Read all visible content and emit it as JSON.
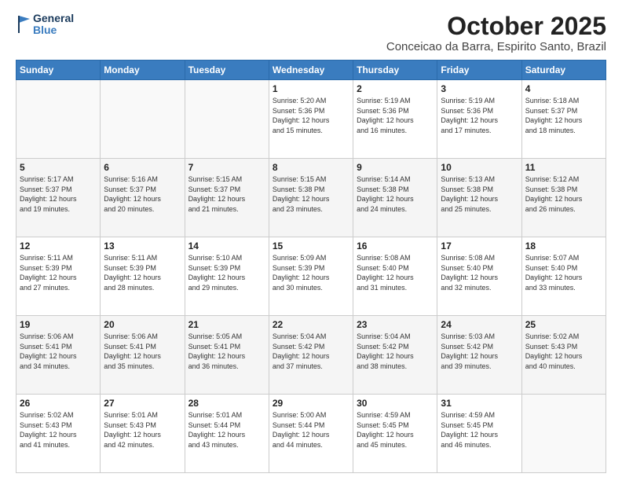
{
  "header": {
    "logo_line1": "General",
    "logo_line2": "Blue",
    "month_title": "October 2025",
    "location": "Conceicao da Barra, Espirito Santo, Brazil"
  },
  "days_of_week": [
    "Sunday",
    "Monday",
    "Tuesday",
    "Wednesday",
    "Thursday",
    "Friday",
    "Saturday"
  ],
  "weeks": [
    [
      {
        "day": "",
        "info": ""
      },
      {
        "day": "",
        "info": ""
      },
      {
        "day": "",
        "info": ""
      },
      {
        "day": "1",
        "info": "Sunrise: 5:20 AM\nSunset: 5:36 PM\nDaylight: 12 hours\nand 15 minutes."
      },
      {
        "day": "2",
        "info": "Sunrise: 5:19 AM\nSunset: 5:36 PM\nDaylight: 12 hours\nand 16 minutes."
      },
      {
        "day": "3",
        "info": "Sunrise: 5:19 AM\nSunset: 5:36 PM\nDaylight: 12 hours\nand 17 minutes."
      },
      {
        "day": "4",
        "info": "Sunrise: 5:18 AM\nSunset: 5:37 PM\nDaylight: 12 hours\nand 18 minutes."
      }
    ],
    [
      {
        "day": "5",
        "info": "Sunrise: 5:17 AM\nSunset: 5:37 PM\nDaylight: 12 hours\nand 19 minutes."
      },
      {
        "day": "6",
        "info": "Sunrise: 5:16 AM\nSunset: 5:37 PM\nDaylight: 12 hours\nand 20 minutes."
      },
      {
        "day": "7",
        "info": "Sunrise: 5:15 AM\nSunset: 5:37 PM\nDaylight: 12 hours\nand 21 minutes."
      },
      {
        "day": "8",
        "info": "Sunrise: 5:15 AM\nSunset: 5:38 PM\nDaylight: 12 hours\nand 23 minutes."
      },
      {
        "day": "9",
        "info": "Sunrise: 5:14 AM\nSunset: 5:38 PM\nDaylight: 12 hours\nand 24 minutes."
      },
      {
        "day": "10",
        "info": "Sunrise: 5:13 AM\nSunset: 5:38 PM\nDaylight: 12 hours\nand 25 minutes."
      },
      {
        "day": "11",
        "info": "Sunrise: 5:12 AM\nSunset: 5:38 PM\nDaylight: 12 hours\nand 26 minutes."
      }
    ],
    [
      {
        "day": "12",
        "info": "Sunrise: 5:11 AM\nSunset: 5:39 PM\nDaylight: 12 hours\nand 27 minutes."
      },
      {
        "day": "13",
        "info": "Sunrise: 5:11 AM\nSunset: 5:39 PM\nDaylight: 12 hours\nand 28 minutes."
      },
      {
        "day": "14",
        "info": "Sunrise: 5:10 AM\nSunset: 5:39 PM\nDaylight: 12 hours\nand 29 minutes."
      },
      {
        "day": "15",
        "info": "Sunrise: 5:09 AM\nSunset: 5:39 PM\nDaylight: 12 hours\nand 30 minutes."
      },
      {
        "day": "16",
        "info": "Sunrise: 5:08 AM\nSunset: 5:40 PM\nDaylight: 12 hours\nand 31 minutes."
      },
      {
        "day": "17",
        "info": "Sunrise: 5:08 AM\nSunset: 5:40 PM\nDaylight: 12 hours\nand 32 minutes."
      },
      {
        "day": "18",
        "info": "Sunrise: 5:07 AM\nSunset: 5:40 PM\nDaylight: 12 hours\nand 33 minutes."
      }
    ],
    [
      {
        "day": "19",
        "info": "Sunrise: 5:06 AM\nSunset: 5:41 PM\nDaylight: 12 hours\nand 34 minutes."
      },
      {
        "day": "20",
        "info": "Sunrise: 5:06 AM\nSunset: 5:41 PM\nDaylight: 12 hours\nand 35 minutes."
      },
      {
        "day": "21",
        "info": "Sunrise: 5:05 AM\nSunset: 5:41 PM\nDaylight: 12 hours\nand 36 minutes."
      },
      {
        "day": "22",
        "info": "Sunrise: 5:04 AM\nSunset: 5:42 PM\nDaylight: 12 hours\nand 37 minutes."
      },
      {
        "day": "23",
        "info": "Sunrise: 5:04 AM\nSunset: 5:42 PM\nDaylight: 12 hours\nand 38 minutes."
      },
      {
        "day": "24",
        "info": "Sunrise: 5:03 AM\nSunset: 5:42 PM\nDaylight: 12 hours\nand 39 minutes."
      },
      {
        "day": "25",
        "info": "Sunrise: 5:02 AM\nSunset: 5:43 PM\nDaylight: 12 hours\nand 40 minutes."
      }
    ],
    [
      {
        "day": "26",
        "info": "Sunrise: 5:02 AM\nSunset: 5:43 PM\nDaylight: 12 hours\nand 41 minutes."
      },
      {
        "day": "27",
        "info": "Sunrise: 5:01 AM\nSunset: 5:43 PM\nDaylight: 12 hours\nand 42 minutes."
      },
      {
        "day": "28",
        "info": "Sunrise: 5:01 AM\nSunset: 5:44 PM\nDaylight: 12 hours\nand 43 minutes."
      },
      {
        "day": "29",
        "info": "Sunrise: 5:00 AM\nSunset: 5:44 PM\nDaylight: 12 hours\nand 44 minutes."
      },
      {
        "day": "30",
        "info": "Sunrise: 4:59 AM\nSunset: 5:45 PM\nDaylight: 12 hours\nand 45 minutes."
      },
      {
        "day": "31",
        "info": "Sunrise: 4:59 AM\nSunset: 5:45 PM\nDaylight: 12 hours\nand 46 minutes."
      },
      {
        "day": "",
        "info": ""
      }
    ]
  ]
}
